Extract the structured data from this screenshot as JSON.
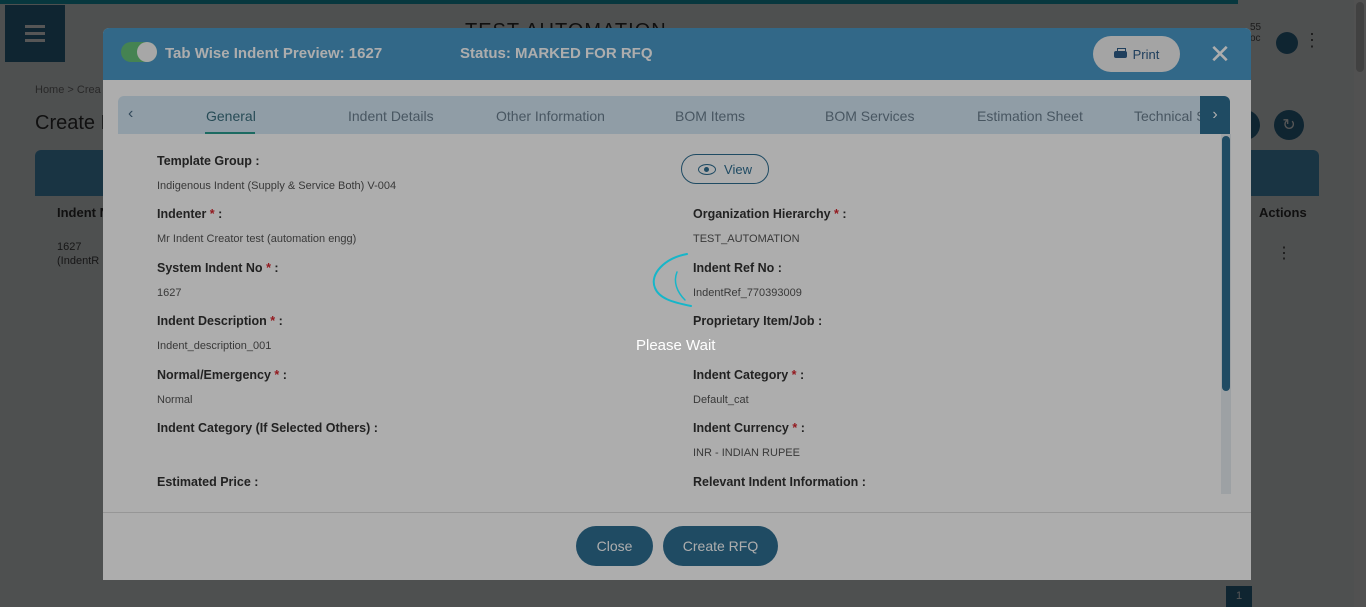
{
  "background": {
    "page_heading": "TEST AUTOMATION",
    "breadcrumb": "Home >  Crea",
    "create_title": "Create R",
    "columns": [
      "Indent N",
      "Actions"
    ],
    "row": {
      "line1": "1627",
      "line2": "(IndentR"
    },
    "pager_current": "1",
    "user_line1": "55",
    "user_line2": "oc"
  },
  "modal": {
    "title": "Tab Wise Indent Preview: 1627",
    "status": "Status: MARKED FOR RFQ",
    "print_label": "Print",
    "close_glyph": "✕",
    "tabs": [
      {
        "label": "General"
      },
      {
        "label": "Indent Details"
      },
      {
        "label": "Other Information"
      },
      {
        "label": "BOM Items"
      },
      {
        "label": "BOM Services"
      },
      {
        "label": "Estimation Sheet"
      },
      {
        "label": "Technical S"
      }
    ],
    "view_label": "View",
    "fields": {
      "template_group": {
        "label": "Template Group :",
        "value": "Indigenous Indent (Supply & Service Both) V-004"
      },
      "indenter": {
        "label": "Indenter",
        "value": "Mr Indent Creator test (automation engg)"
      },
      "org_hierarchy": {
        "label": "Organization Hierarchy",
        "value": "TEST_AUTOMATION"
      },
      "system_indent_no": {
        "label": "System Indent No",
        "value": "1627"
      },
      "indent_ref_no": {
        "label": "Indent Ref No :",
        "value": "IndentRef_770393009"
      },
      "indent_description": {
        "label": "Indent Description",
        "value": "Indent_description_001"
      },
      "proprietary": {
        "label": "Proprietary Item/Job :",
        "value": ""
      },
      "normal_emergency": {
        "label": "Normal/Emergency",
        "value": "Normal"
      },
      "indent_category": {
        "label": "Indent Category",
        "value": "Default_cat"
      },
      "indent_category_others": {
        "label": "Indent Category (If Selected Others) :",
        "value": ""
      },
      "indent_currency": {
        "label": "Indent Currency",
        "value": "INR - INDIAN RUPEE"
      },
      "estimated_price": {
        "label": "Estimated Price :",
        "value": ""
      },
      "relevant_info": {
        "label": "Relevant Indent Information :",
        "value": ""
      }
    },
    "required_mark": "*",
    "colon": ":",
    "footer": {
      "close_label": "Close",
      "create_rfq_label": "Create RFQ"
    }
  },
  "loading": {
    "message": "Please Wait"
  },
  "colors": {
    "header": "#4a9ac9",
    "primary": "#2f6f93",
    "accent_line": "#17a2b8"
  },
  "icons": [
    "menu-icon",
    "user-avatar-icon",
    "printer-icon",
    "close-icon",
    "eye-icon",
    "chevron-left-icon",
    "chevron-right-icon",
    "refresh-icon",
    "spinner-icon"
  ]
}
